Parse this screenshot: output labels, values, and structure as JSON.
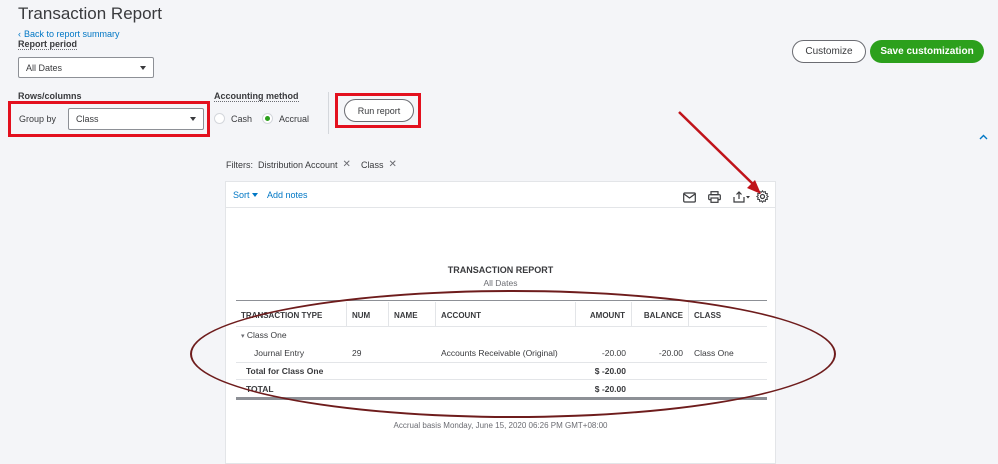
{
  "page": {
    "title": "Transaction Report",
    "back_link": "Back to report summary"
  },
  "report_period": {
    "label": "Report period",
    "value": "All Dates"
  },
  "rows_columns": {
    "label": "Rows/columns",
    "group_by_label": "Group by",
    "group_by_value": "Class"
  },
  "accounting_method": {
    "label": "Accounting method",
    "options": [
      {
        "label": "Cash",
        "selected": false
      },
      {
        "label": "Accrual",
        "selected": true
      }
    ]
  },
  "actions": {
    "run_report": "Run report",
    "customize": "Customize",
    "save_customization": "Save customization"
  },
  "filters": {
    "label": "Filters:",
    "items": [
      "Distribution Account",
      "Class"
    ]
  },
  "toolbar": {
    "sort": "Sort",
    "add_notes": "Add notes",
    "icons": [
      "email-icon",
      "print-icon",
      "export-icon",
      "settings-gear-icon"
    ]
  },
  "report": {
    "title": "TRANSACTION REPORT",
    "subtitle": "All Dates",
    "columns": [
      "TRANSACTION TYPE",
      "NUM",
      "NAME",
      "ACCOUNT",
      "AMOUNT",
      "BALANCE",
      "CLASS"
    ],
    "group_name": "Class One",
    "rows": [
      {
        "type": "Journal Entry",
        "num": "29",
        "name": "",
        "account": "Accounts Receivable (Original)",
        "amount": "-20.00",
        "balance": "-20.00",
        "class": "Class One"
      }
    ],
    "group_total_label": "Total for Class One",
    "group_total_amount": "$ -20.00",
    "total_label": "TOTAL",
    "total_amount": "$ -20.00",
    "footer": "Accrual basis  Monday, June 15, 2020   06:26 PM GMT+08:00"
  },
  "colors": {
    "accent_blue": "#0077c5",
    "brand_green": "#2ca01c",
    "highlight_red": "#e3101e",
    "annotation_maroon": "#6e1c1c",
    "arrow_red": "#c0131a"
  }
}
